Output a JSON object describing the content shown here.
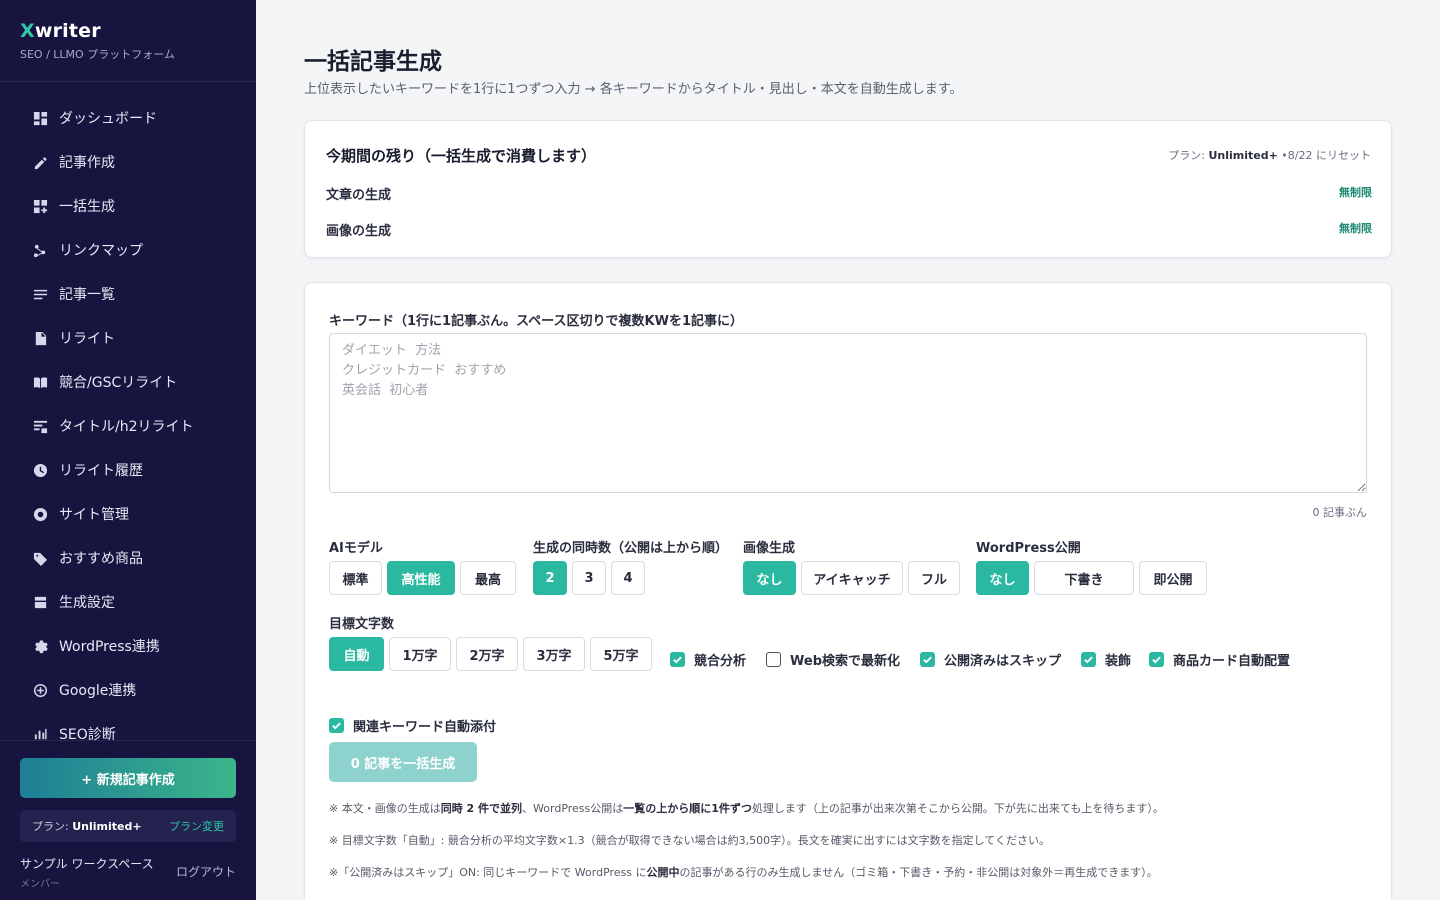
{
  "brand": {
    "x": "X",
    "name": "writer",
    "subtitle": "SEO / LLMO プラットフォーム"
  },
  "sidebar": {
    "items": [
      {
        "label": "ダッシュボード",
        "icon": "dashboard-icon"
      },
      {
        "label": "記事作成",
        "icon": "pencil-icon"
      },
      {
        "label": "一括生成",
        "icon": "grid-add-icon"
      },
      {
        "label": "リンクマップ",
        "icon": "link-map-icon"
      },
      {
        "label": "記事一覧",
        "icon": "list-icon"
      },
      {
        "label": "リライト",
        "icon": "document-icon"
      },
      {
        "label": "競合/GSCリライト",
        "icon": "book-icon"
      },
      {
        "label": "タイトル/h2リライト",
        "icon": "title-icon"
      },
      {
        "label": "リライト履歴",
        "icon": "clock-icon"
      },
      {
        "label": "サイト管理",
        "icon": "site-icon"
      },
      {
        "label": "おすすめ商品",
        "icon": "tag-icon"
      },
      {
        "label": "生成設定",
        "icon": "settings-box-icon"
      },
      {
        "label": "WordPress連携",
        "icon": "gear-icon"
      },
      {
        "label": "Google連携",
        "icon": "plus-circle-icon"
      },
      {
        "label": "SEO診断",
        "icon": "chart-icon"
      }
    ],
    "new_button": "+ 新規記事作成",
    "plan_prefix": "プラン: ",
    "plan_name": "Unlimited+",
    "plan_change": "プラン変更",
    "workspace_name": "サンプル ワークスペース",
    "workspace_role": "メンバー",
    "logout": "ログアウト"
  },
  "header": {
    "title": "一括記事生成",
    "subtitle": "上位表示したいキーワードを1行に1つずつ入力 → 各キーワードからタイトル・見出し・本文を自動生成します。"
  },
  "quota": {
    "title": "今期間の残り（一括生成で消費します）",
    "plan_prefix": "プラン: ",
    "plan_name": "Unlimited+",
    "reset": " •8/22 にリセット",
    "rows": [
      {
        "label": "文章の生成",
        "value": "無制限"
      },
      {
        "label": "画像の生成",
        "value": "無制限"
      }
    ]
  },
  "form": {
    "keyword_label": "キーワード（1行に1記事ぶん。スペース区切りで複数KWを1記事に）",
    "keyword_placeholder": "ダイエット  方法\nクレジットカード  おすすめ\n英会話  初心者",
    "keyword_value": "",
    "count_text": "0 記事ぶん",
    "ai_model": {
      "label": "AIモデル",
      "options": [
        "標準",
        "高性能",
        "最高"
      ],
      "selected": "高性能"
    },
    "concurrency": {
      "label": "生成の同時数（公開は上から順）",
      "options": [
        "2",
        "3",
        "4"
      ],
      "selected": "2"
    },
    "image_gen": {
      "label": "画像生成",
      "options": [
        "なし",
        "アイキャッチ",
        "フル"
      ],
      "selected": "なし"
    },
    "wp_publish": {
      "label": "WordPress公開",
      "options": [
        "なし",
        "下書き",
        "即公開"
      ],
      "selected": "なし"
    },
    "target_chars": {
      "label": "目標文字数",
      "options": [
        "自動",
        "1万字",
        "2万字",
        "3万字",
        "5万字"
      ],
      "selected": "自動"
    },
    "checks": [
      {
        "label": "競合分析",
        "checked": true
      },
      {
        "label": "Web検索で最新化",
        "checked": false
      },
      {
        "label": "公開済みはスキップ",
        "checked": true
      },
      {
        "label": "装飾",
        "checked": true
      },
      {
        "label": "商品カード自動配置",
        "checked": true
      },
      {
        "label": "関連キーワード自動添付",
        "checked": true
      }
    ],
    "generate_button": "0 記事を一括生成",
    "notes": [
      [
        "※ 本文・画像の生成は",
        "同時 2 件で並列",
        "、WordPress公開は",
        "一覧の上から順に1件ずつ",
        "処理します（上の記事が出来次第そこから公開。下が先に出来ても上を待ちます）。"
      ],
      [
        "※ 目標文字数「自動」: 競合分析の平均文字数×1.3（競合が取得できない場合は約3,500字）。長文を確実に出すには文字数を指定してください。"
      ],
      [
        "※「公開済みはスキップ」ON: 同じキーワードで WordPress に",
        "公開中",
        "の記事がある行のみ生成しません（ゴミ箱・下書き・予約・非公開は対象外＝再生成できます）。"
      ]
    ]
  },
  "colors": {
    "sidebar_bg": "#17153f",
    "accent": "#2ab9a0",
    "brand_x": "#2ec7a8"
  }
}
